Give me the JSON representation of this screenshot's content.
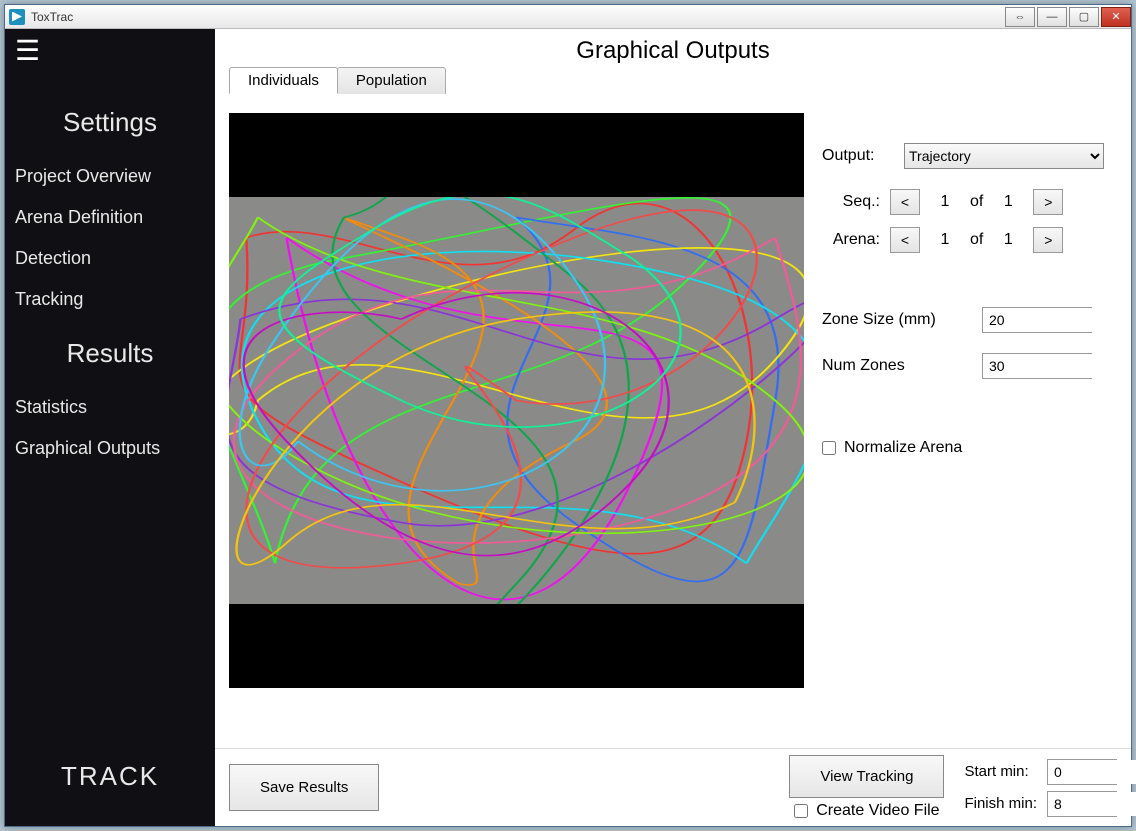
{
  "window": {
    "title": "ToxTrac"
  },
  "sidebar": {
    "sections": {
      "settings": {
        "heading": "Settings",
        "items": [
          "Project Overview",
          "Arena Definition",
          "Detection",
          "Tracking"
        ]
      },
      "results": {
        "heading": "Results",
        "items": [
          "Statistics",
          "Graphical Outputs"
        ]
      }
    },
    "track_label": "TRACK"
  },
  "page": {
    "title": "Graphical Outputs",
    "tabs": {
      "individuals": "Individuals",
      "population": "Population",
      "active": "individuals"
    }
  },
  "controls": {
    "output": {
      "label": "Output:",
      "value": "Trajectory"
    },
    "seq": {
      "label": "Seq.:",
      "current": "1",
      "of_text": "of",
      "total": "1",
      "prev": "<",
      "next": ">"
    },
    "arena": {
      "label": "Arena:",
      "current": "1",
      "of_text": "of",
      "total": "1",
      "prev": "<",
      "next": ">"
    },
    "zone_size": {
      "label": "Zone Size (mm)",
      "value": "20"
    },
    "num_zones": {
      "label": "Num Zones",
      "value": "30"
    },
    "normalize": {
      "label": "Normalize Arena",
      "checked": false
    }
  },
  "footer": {
    "save_label": "Save Results",
    "view_label": "View Tracking",
    "create_video_label": "Create Video File",
    "start": {
      "label": "Start min:",
      "value": "0"
    },
    "finish": {
      "label": "Finish min:",
      "value": "8"
    }
  },
  "colors": {
    "accent": "#1e90c0",
    "sidebar_bg": "#0f0f14"
  }
}
